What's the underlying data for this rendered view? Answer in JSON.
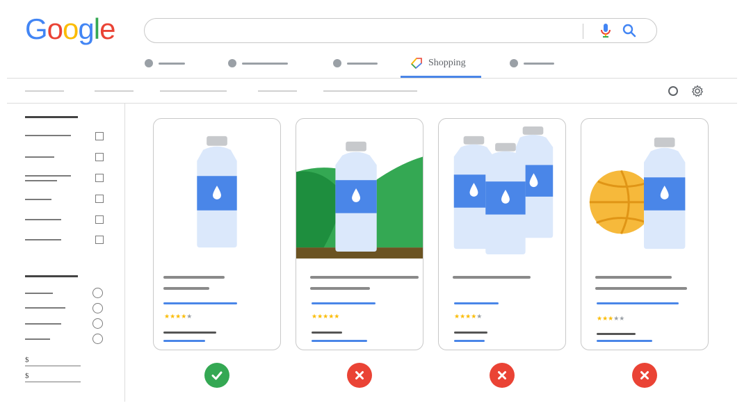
{
  "logo": {
    "letters": [
      "G",
      "o",
      "o",
      "g",
      "l",
      "e"
    ],
    "colors": [
      "#4285F4",
      "#EA4335",
      "#FBBC05",
      "#4285F4",
      "#34A853",
      "#EA4335"
    ]
  },
  "search": {
    "value": "",
    "mic_icon": "mic-icon",
    "search_icon": "search-icon"
  },
  "tabs": {
    "active_label": "Shopping"
  },
  "products": [
    {
      "rating": 4,
      "verdict": "approved"
    },
    {
      "rating": 5,
      "verdict": "rejected"
    },
    {
      "rating": 4,
      "verdict": "rejected"
    },
    {
      "rating": 3,
      "verdict": "rejected"
    }
  ],
  "filters": {
    "price_symbols": [
      "$",
      "$"
    ]
  },
  "colors": {
    "accent": "#4a86e8",
    "approved": "#34a853",
    "rejected": "#ea4335",
    "bottle": "#dbe8fb",
    "label": "#4a86e8",
    "cap": "#c7c9cc",
    "star": "#fbbc04"
  }
}
